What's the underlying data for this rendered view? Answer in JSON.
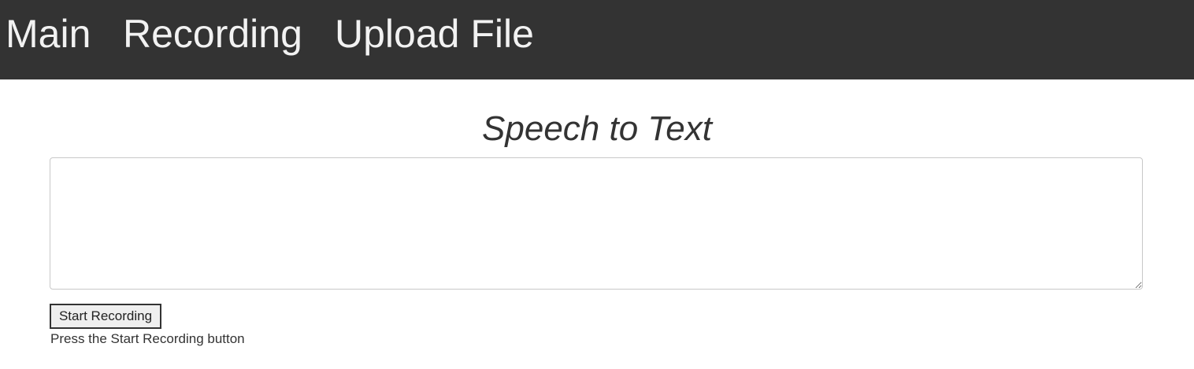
{
  "nav": {
    "items": [
      {
        "label": "Main"
      },
      {
        "label": "Recording"
      },
      {
        "label": "Upload File"
      }
    ]
  },
  "main": {
    "title": "Speech to Text",
    "transcript_value": "",
    "start_button_label": "Start Recording",
    "status_text": "Press the Start Recording button"
  },
  "colors": {
    "nav_background": "#333333",
    "nav_text": "#f2f2f2",
    "body_text": "#333333"
  }
}
